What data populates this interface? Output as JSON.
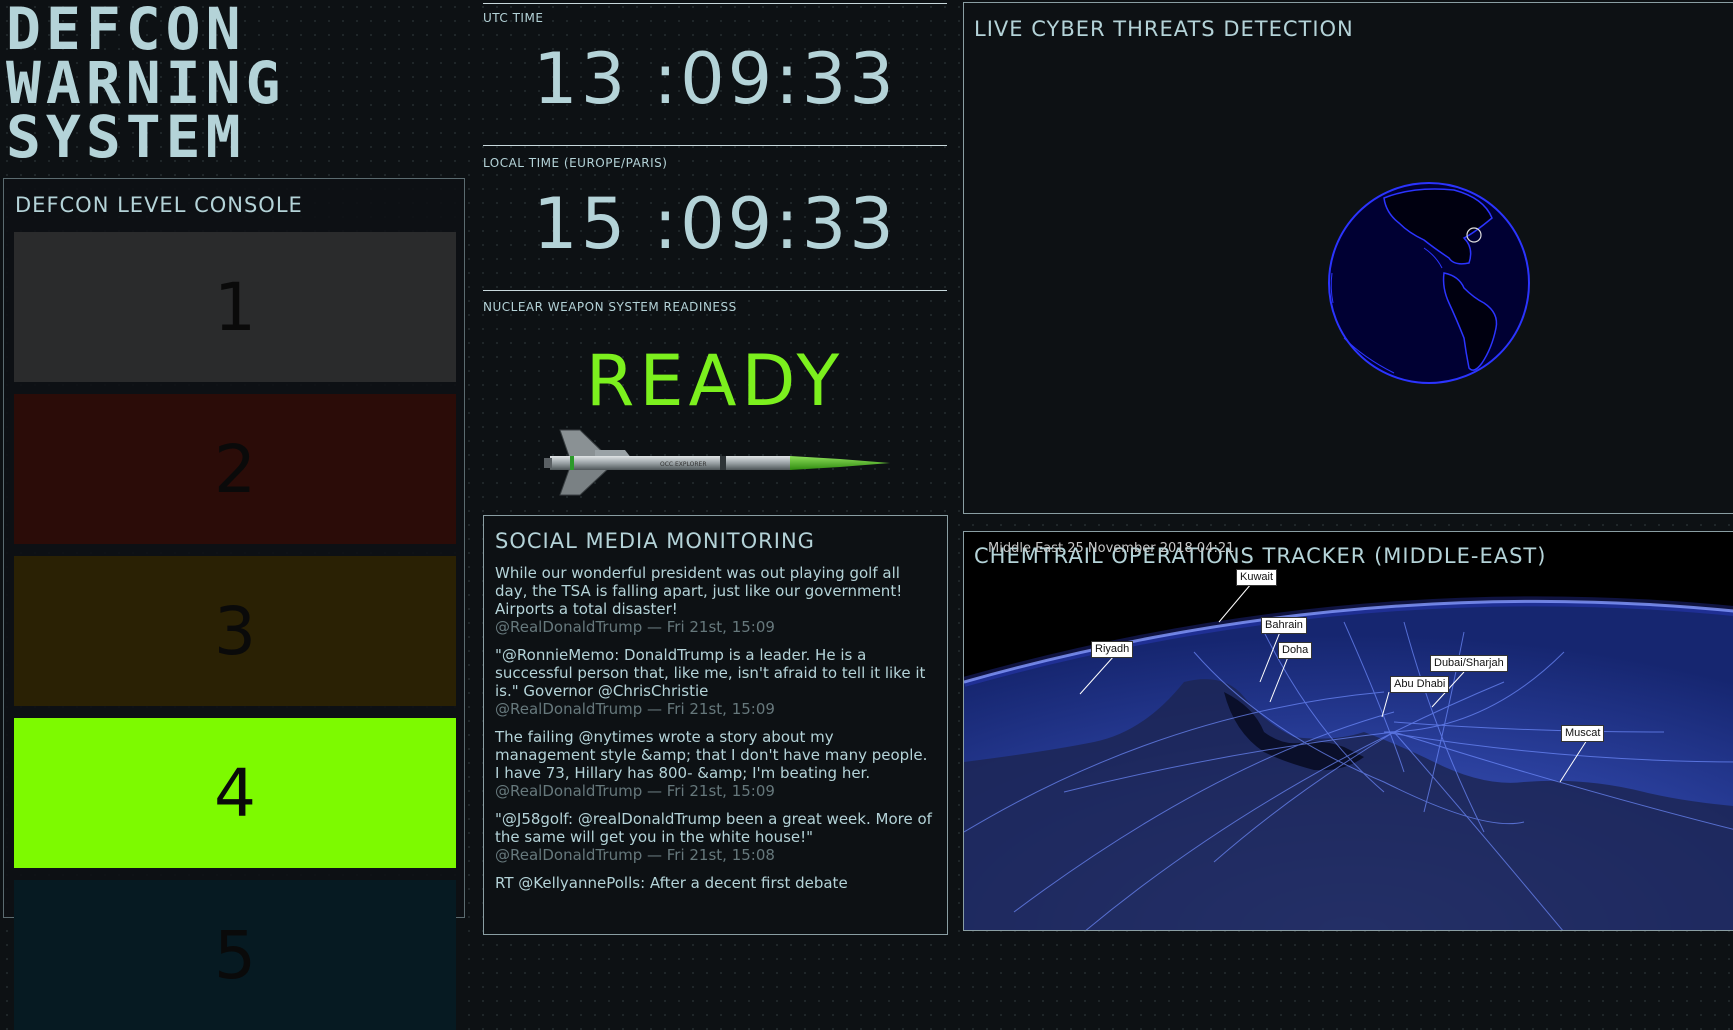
{
  "title": {
    "line1": "DEFCON",
    "line2": "WARNING",
    "line3": "SYSTEM"
  },
  "console": {
    "heading": "DEFCON LEVEL CONSOLE",
    "levels": [
      {
        "label": "1",
        "color": "#2a2b2c"
      },
      {
        "label": "2",
        "color": "#2b0c08"
      },
      {
        "label": "3",
        "color": "#2a2104"
      },
      {
        "label": "4",
        "color": "#7dfa00"
      },
      {
        "label": "5",
        "color": "#061a22"
      }
    ],
    "active_level": "4"
  },
  "utc": {
    "label": "UTC TIME",
    "time": "13 :09:33"
  },
  "local": {
    "label": "LOCAL TIME (EUROPE/PARIS)",
    "time": "15 :09:33"
  },
  "nuclear": {
    "label": "NUCLEAR WEAPON SYSTEM READINESS",
    "status": "READY",
    "status_color": "#7cf01e",
    "missile_text": "OCC EXPLORER"
  },
  "social": {
    "heading": "SOCIAL MEDIA MONITORING",
    "tweets": [
      {
        "text": "While our wonderful president was out playing golf all day, the TSA is falling apart, just like our government! Airports a total disaster!",
        "meta": "@RealDonaldTrump — Fri 21st, 15:09"
      },
      {
        "text": "\"@RonnieMemo: DonaldTrump is a leader. He is a successful person that, like me, isn't afraid to tell it like it is.\" Governor @ChrisChristie",
        "meta": "@RealDonaldTrump — Fri 21st, 15:09"
      },
      {
        "text": "The failing @nytimes wrote a story about my management style &amp; that I don't have many people. I have 73, Hillary has 800- &amp; I'm beating her.",
        "meta": "@RealDonaldTrump — Fri 21st, 15:09"
      },
      {
        "text": "\"@J58golf: @realDonaldTrump been a great week. More of the same will get you in the white house!\"",
        "meta": "@RealDonaldTrump — Fri 21st, 15:08"
      },
      {
        "text": "RT @KellyannePolls: After a decent first debate",
        "meta": ""
      }
    ]
  },
  "threats": {
    "heading": "LIVE CYBER THREATS DETECTION"
  },
  "chem": {
    "heading": "CHEMTRAIL OPERATIONS TRACKER (MIDDLE-EAST)",
    "overlay": "Middle East 25 November 2018 04:21",
    "cities": [
      "Kuwait",
      "Bahrain",
      "Riyadh",
      "Doha",
      "Dubai/Sharjah",
      "Abu Dhabi",
      "Muscat"
    ]
  },
  "colors": {
    "accent": "#b4d3d8",
    "ready": "#7cf01e",
    "globe": "#000033",
    "globe_lines": "#2b34ff"
  }
}
